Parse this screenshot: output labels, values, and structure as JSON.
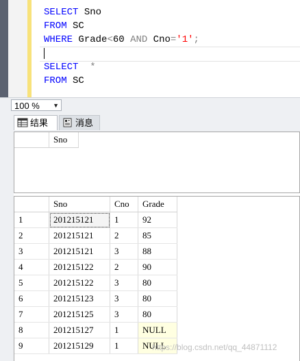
{
  "editor": {
    "line1": {
      "kw1": "SELECT",
      "rest": " Sno"
    },
    "line2": {
      "kw1": "FROM",
      "rest": " SC"
    },
    "line3": {
      "kw1": "WHERE",
      "mid1": " Grade",
      "op1": "<",
      "mid2": "60 ",
      "op2": "AND",
      "mid3": " Cno",
      "op3": "=",
      "str": "'1'",
      "op4": ";"
    },
    "line5": {
      "kw1": "SELECT",
      "rest": "  ",
      "op1": "*"
    },
    "line6": {
      "kw1": "FROM",
      "rest": " SC"
    }
  },
  "zoom": {
    "value": "100 %",
    "arrow": "▼"
  },
  "tabs": {
    "results": "结果",
    "messages": "消息"
  },
  "result1": {
    "columns": [
      "Sno"
    ]
  },
  "result2": {
    "columns": [
      "Sno",
      "Cno",
      "Grade"
    ],
    "rows": [
      [
        "1",
        "201215121",
        "1",
        "92"
      ],
      [
        "2",
        "201215121",
        "2",
        "85"
      ],
      [
        "3",
        "201215121",
        "3",
        "88"
      ],
      [
        "4",
        "201215122",
        "2",
        "90"
      ],
      [
        "5",
        "201215122",
        "3",
        "80"
      ],
      [
        "6",
        "201215123",
        "3",
        "80"
      ],
      [
        "7",
        "201215125",
        "3",
        "80"
      ],
      [
        "8",
        "201215127",
        "1",
        "NULL"
      ],
      [
        "9",
        "201215129",
        "1",
        "NULL"
      ]
    ]
  },
  "watermark": "https://blog.csdn.net/qq_44871112"
}
